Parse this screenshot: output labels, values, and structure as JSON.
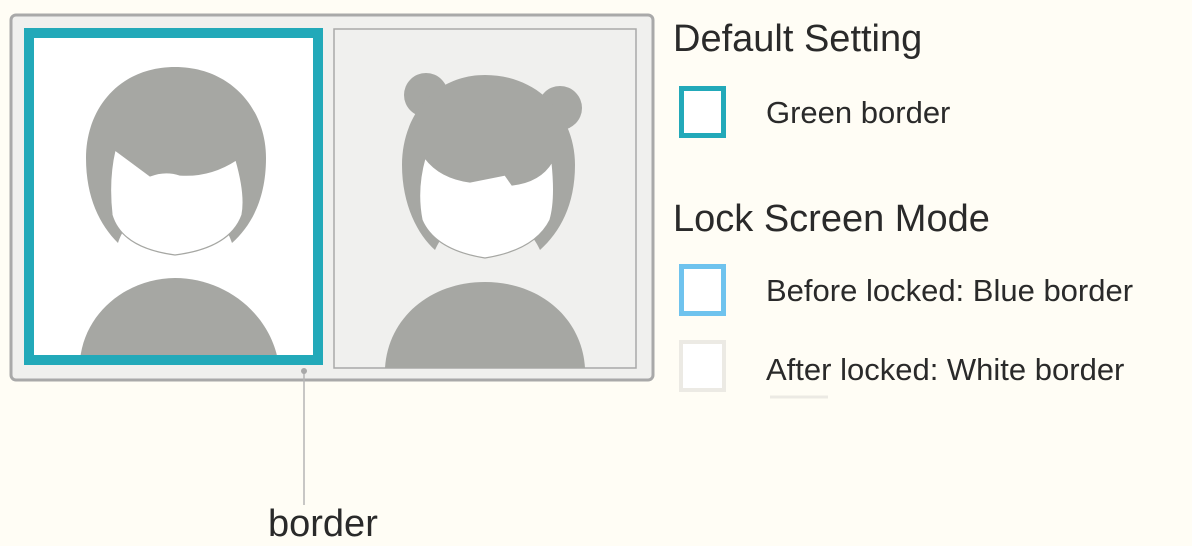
{
  "colors": {
    "teal": "#22a9b9",
    "blue": "#6fc3ee",
    "white_border": "#eceae4",
    "silhouette": "#a6a7a3",
    "panel_bg": "#f0f0ee",
    "frame": "#a9a9a9"
  },
  "default_setting": {
    "heading": "Default Setting",
    "green_border_label": "Green border"
  },
  "lock_screen_mode": {
    "heading": "Lock Screen Mode",
    "before_label": "Before locked: Blue border",
    "after_label": "After locked: White border"
  },
  "callout": {
    "label": "border"
  }
}
